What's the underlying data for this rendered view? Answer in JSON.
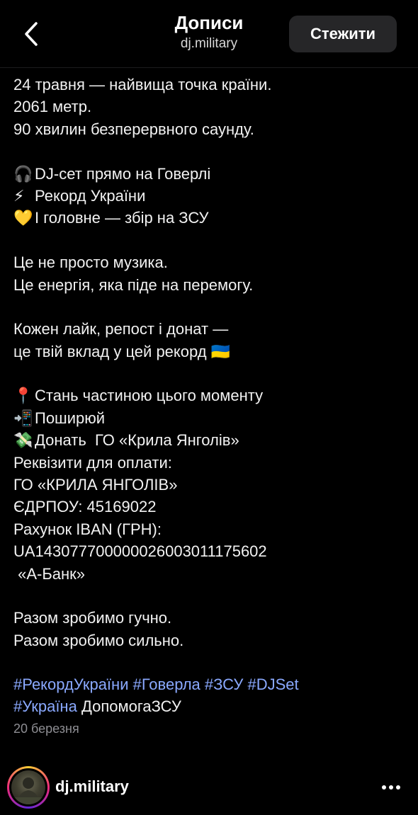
{
  "header": {
    "title": "Дописи",
    "subtitle": "dj.military",
    "follow_label": "Стежити"
  },
  "caption": {
    "lines": [
      {
        "text": "24 травня — найвища точка країни."
      },
      {
        "text": "2061 метр."
      },
      {
        "text": "90 хвилин безперервного саунду."
      },
      {
        "text": ""
      },
      {
        "emoji": "🎧",
        "text": "DJ-сет прямо на Говерлі"
      },
      {
        "emoji": "⚡",
        "text": "Рекорд України"
      },
      {
        "emoji": "💛",
        "text": "І головне — збір на ЗСУ"
      },
      {
        "text": ""
      },
      {
        "text": "Це не просто музика."
      },
      {
        "text": "Це енергія, яка піде на перемогу."
      },
      {
        "text": ""
      },
      {
        "text": "Кожен лайк, репост і донат —"
      },
      {
        "text": "це твій вклад у цей рекорд",
        "emoji_after": "🇺🇦"
      },
      {
        "text": ""
      },
      {
        "emoji": "📍",
        "text": "Стань частиною цього моменту"
      },
      {
        "emoji": "📲",
        "text": "Поширюй"
      },
      {
        "emoji": "💸",
        "text": "Донать  ГО «Крила Янголів»"
      },
      {
        "text": "Реквізити для оплати:"
      },
      {
        "text": "ГО «КРИЛА ЯНГОЛІВ»"
      },
      {
        "text": "ЄДРПОУ: 45169022"
      },
      {
        "text": "Рахунок IBAN (ГРН):"
      },
      {
        "text": "UA143077700000026003011175602"
      },
      {
        "text": " «А-Банк»"
      },
      {
        "text": ""
      },
      {
        "text": "Разом зробимо гучно."
      },
      {
        "text": "Разом зробимо сильно."
      }
    ]
  },
  "hashtags": {
    "line1": [
      "#РекордУкраїни",
      "#Говерла",
      "#ЗСУ",
      "#DJSet"
    ],
    "line2_tag": "#Україна",
    "line2_plain": "ДопомогаЗСУ",
    "color": "#8aa9ff"
  },
  "post": {
    "date": "20 березня"
  },
  "footer": {
    "username": "dj.military",
    "avatar_icon": "avatar-photo"
  },
  "icons": {
    "back": "chevron-left-icon",
    "more": "more-horizontal-icon"
  },
  "colors": {
    "background": "#000000",
    "text": "#f2f2f2",
    "link": "#8aa9ff",
    "muted": "#8e8e93",
    "button_bg": "#262628"
  }
}
